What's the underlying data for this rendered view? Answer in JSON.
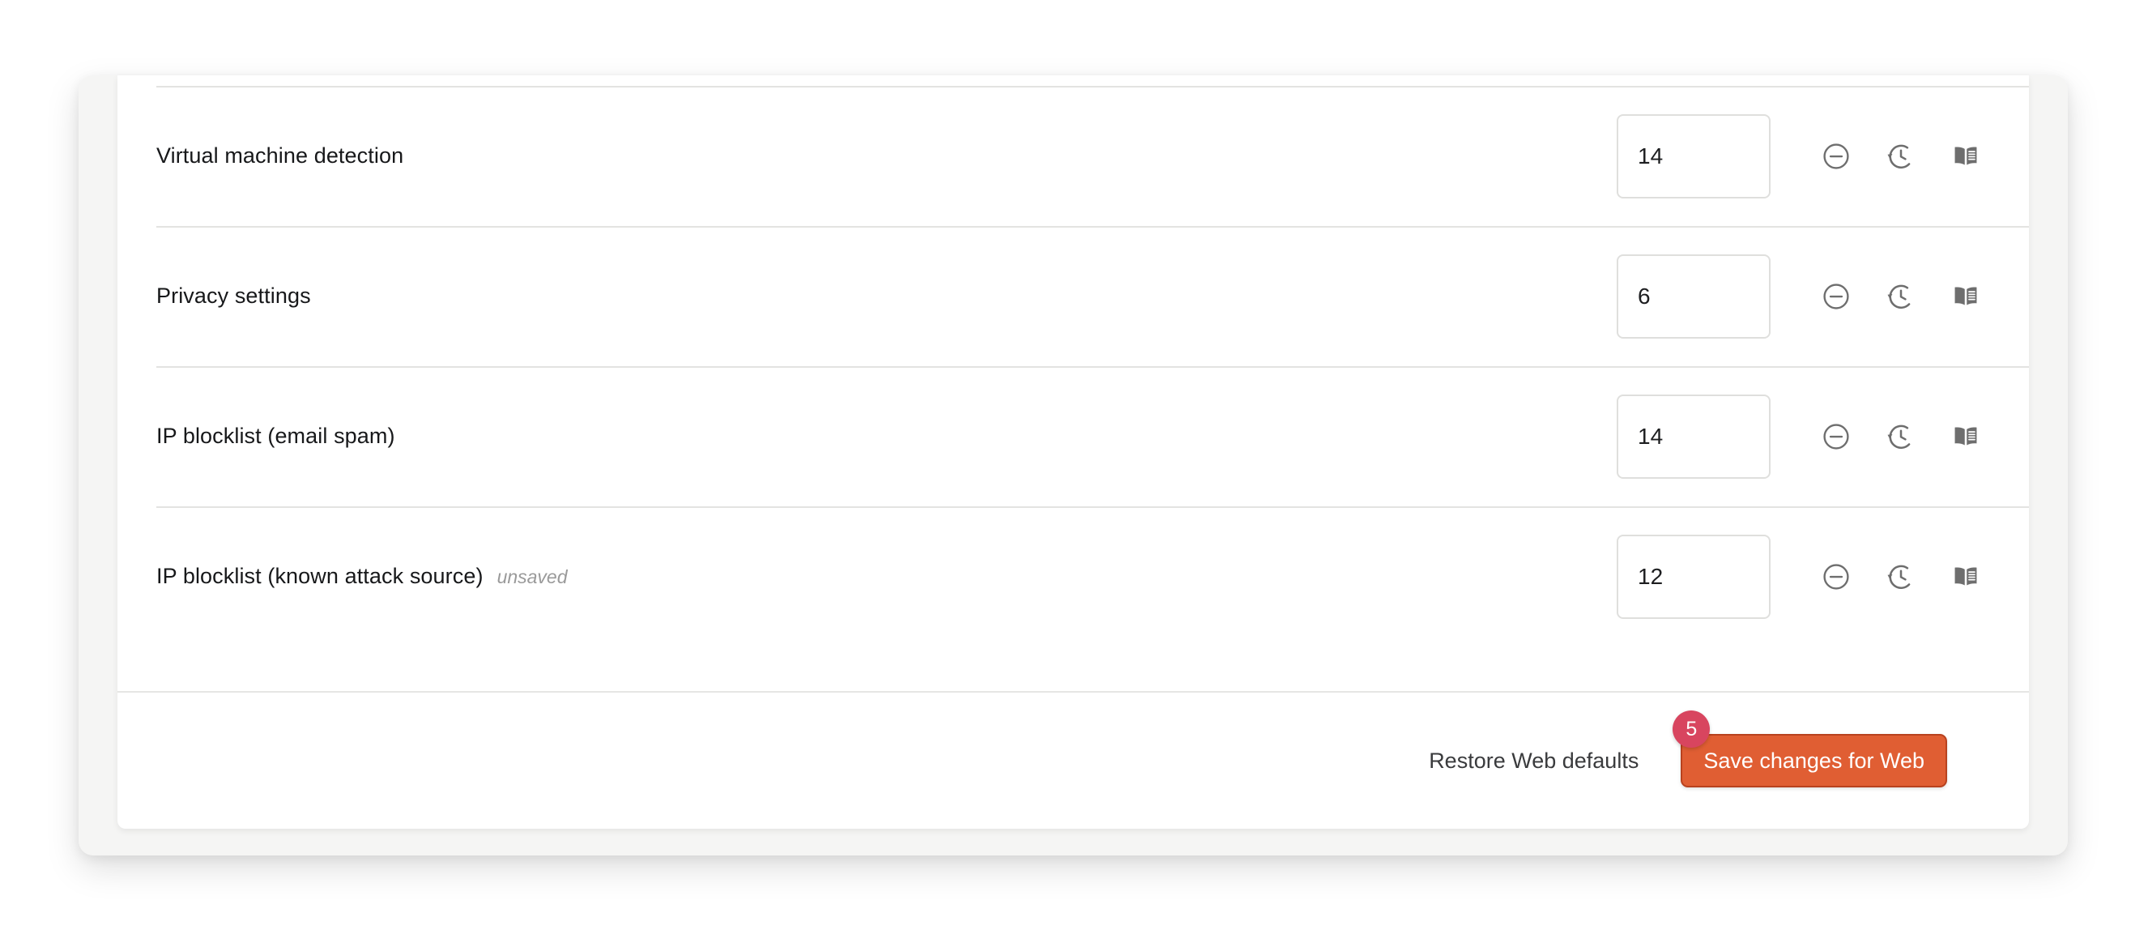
{
  "panel": {
    "rows": [
      {
        "label": "Virtual machine detection",
        "flag": "",
        "value": "14",
        "actions": [
          "disable-icon",
          "history-icon",
          "docs-icon"
        ]
      },
      {
        "label": "Privacy settings",
        "flag": "",
        "value": "6",
        "actions": [
          "disable-icon",
          "history-icon",
          "docs-icon"
        ]
      },
      {
        "label": "IP blocklist (email spam)",
        "flag": "",
        "value": "14",
        "actions": [
          "disable-icon",
          "history-icon",
          "docs-icon"
        ]
      },
      {
        "label": "IP blocklist (known attack source)",
        "flag": "unsaved",
        "value": "12",
        "actions": [
          "disable-icon",
          "history-icon",
          "docs-icon"
        ]
      }
    ]
  },
  "footer": {
    "restore_label": "Restore Web defaults",
    "save_label": "Save changes for Web",
    "unsaved_count": "5"
  },
  "colors": {
    "save_button_background": "#e05e33",
    "save_button_border": "#b8421f",
    "badge_background": "#d8455f",
    "row_divider": "#e3e3e1",
    "input_border": "#dfdfdd",
    "label_text": "#17181a",
    "flag_text": "#9a9a9a",
    "icon_gray": "#6e6e6e",
    "shell_background": "#f5f5f4",
    "card_background": "#ffffff"
  }
}
